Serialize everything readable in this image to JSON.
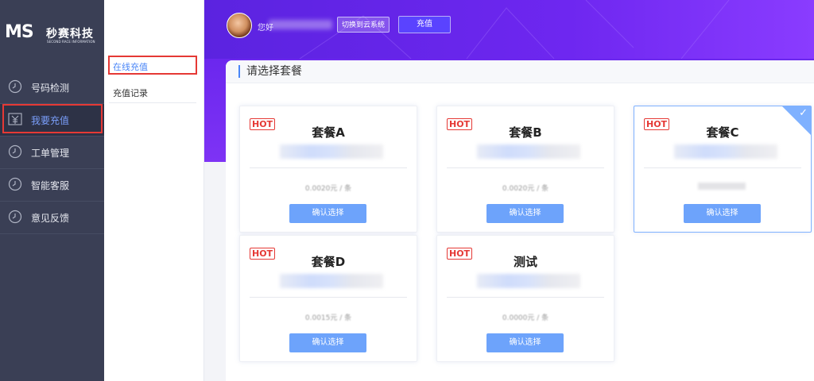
{
  "logo": {
    "mark": "MS",
    "name_cn": "秒赛科技",
    "name_en": "SECOND RACE INFORMATION"
  },
  "sidebar": {
    "items": [
      {
        "label": "号码检测",
        "icon": "clock-icon"
      },
      {
        "label": "我要充值",
        "icon": "yuan-icon",
        "active": true
      },
      {
        "label": "工单管理",
        "icon": "clock-icon"
      },
      {
        "label": "智能客服",
        "icon": "clock-icon"
      },
      {
        "label": "意见反馈",
        "icon": "clock-icon"
      }
    ]
  },
  "subnav": {
    "items": [
      {
        "label": "在线充值",
        "active": true
      },
      {
        "label": "充值记录"
      }
    ]
  },
  "header": {
    "greeting": "您好",
    "switch_label": "切换到云系统",
    "recharge_label": "充值"
  },
  "main": {
    "title": "请选择套餐",
    "packages": [
      {
        "hot": "HOT",
        "name": "套餐A",
        "price": "0.0020元 / 条",
        "button": "确认选择",
        "selected": false
      },
      {
        "hot": "HOT",
        "name": "套餐B",
        "price": "0.0020元 / 条",
        "button": "确认选择",
        "selected": false
      },
      {
        "hot": "HOT",
        "name": "套餐C",
        "price": "",
        "button": "确认选择",
        "selected": true
      },
      {
        "hot": "HOT",
        "name": "套餐D",
        "price": "0.0015元 / 条",
        "button": "确认选择",
        "selected": false
      },
      {
        "hot": "HOT",
        "name": "测试",
        "price": "0.0000元 / 条",
        "button": "确认选择",
        "selected": false
      }
    ]
  },
  "colors": {
    "accent": "#4a86f7",
    "sidebar_bg": "#3a3f55",
    "header_purple": "#6b27ee",
    "hot_red": "#e53935"
  }
}
